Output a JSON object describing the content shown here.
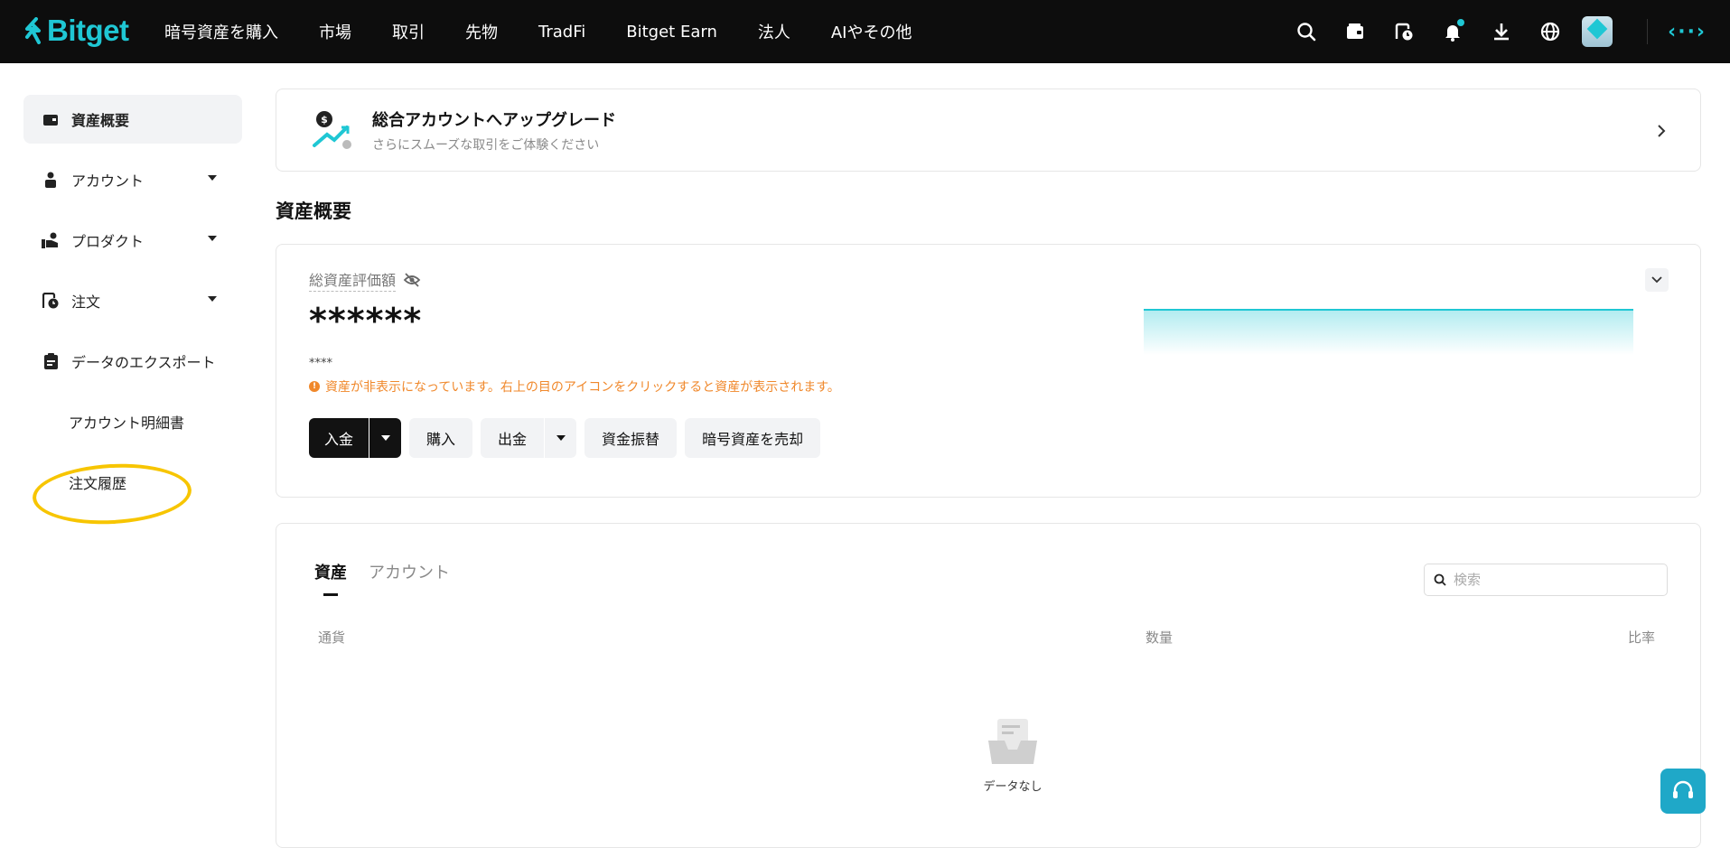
{
  "brand": {
    "name": "Bitget",
    "accent": "#1fc7d4"
  },
  "nav": {
    "items": [
      "暗号資産を購入",
      "市場",
      "取引",
      "先物",
      "TradFi",
      "Bitget Earn",
      "法人",
      "AIやその他"
    ]
  },
  "topbar_icons": [
    "search-icon",
    "wallet-icon",
    "order-history-icon",
    "bell-icon",
    "download-icon",
    "globe-icon"
  ],
  "sidebar": {
    "items": [
      {
        "label": "資産概要",
        "icon": "wallet-icon",
        "active": true
      },
      {
        "label": "アカウント",
        "icon": "user-icon"
      },
      {
        "label": "プロダクト",
        "icon": "product-icon"
      },
      {
        "label": "注文",
        "icon": "order-icon"
      },
      {
        "label": "データのエクスポート",
        "icon": "export-icon"
      }
    ],
    "subitems": [
      "アカウント明細書",
      "注文履歴"
    ]
  },
  "upgrade_banner": {
    "title": "総合アカウントへアップグレード",
    "subtitle": "さらにスムーズな取引をご体験ください"
  },
  "page_title": "資産概要",
  "overview": {
    "label": "総資産評価額",
    "value_masked": "******",
    "sub_value_masked": "****",
    "warning": "資産が非表示になっています。右上の目のアイコンをクリックすると資産が表示されます。",
    "buttons": {
      "deposit": "入金",
      "buy": "購入",
      "withdraw": "出金",
      "transfer": "資金振替",
      "sell": "暗号資産を売却"
    }
  },
  "assets": {
    "tabs": [
      "資産",
      "アカウント"
    ],
    "search_placeholder": "検索",
    "columns": [
      "通貨",
      "数量",
      "比率"
    ],
    "empty_text": "データなし"
  }
}
